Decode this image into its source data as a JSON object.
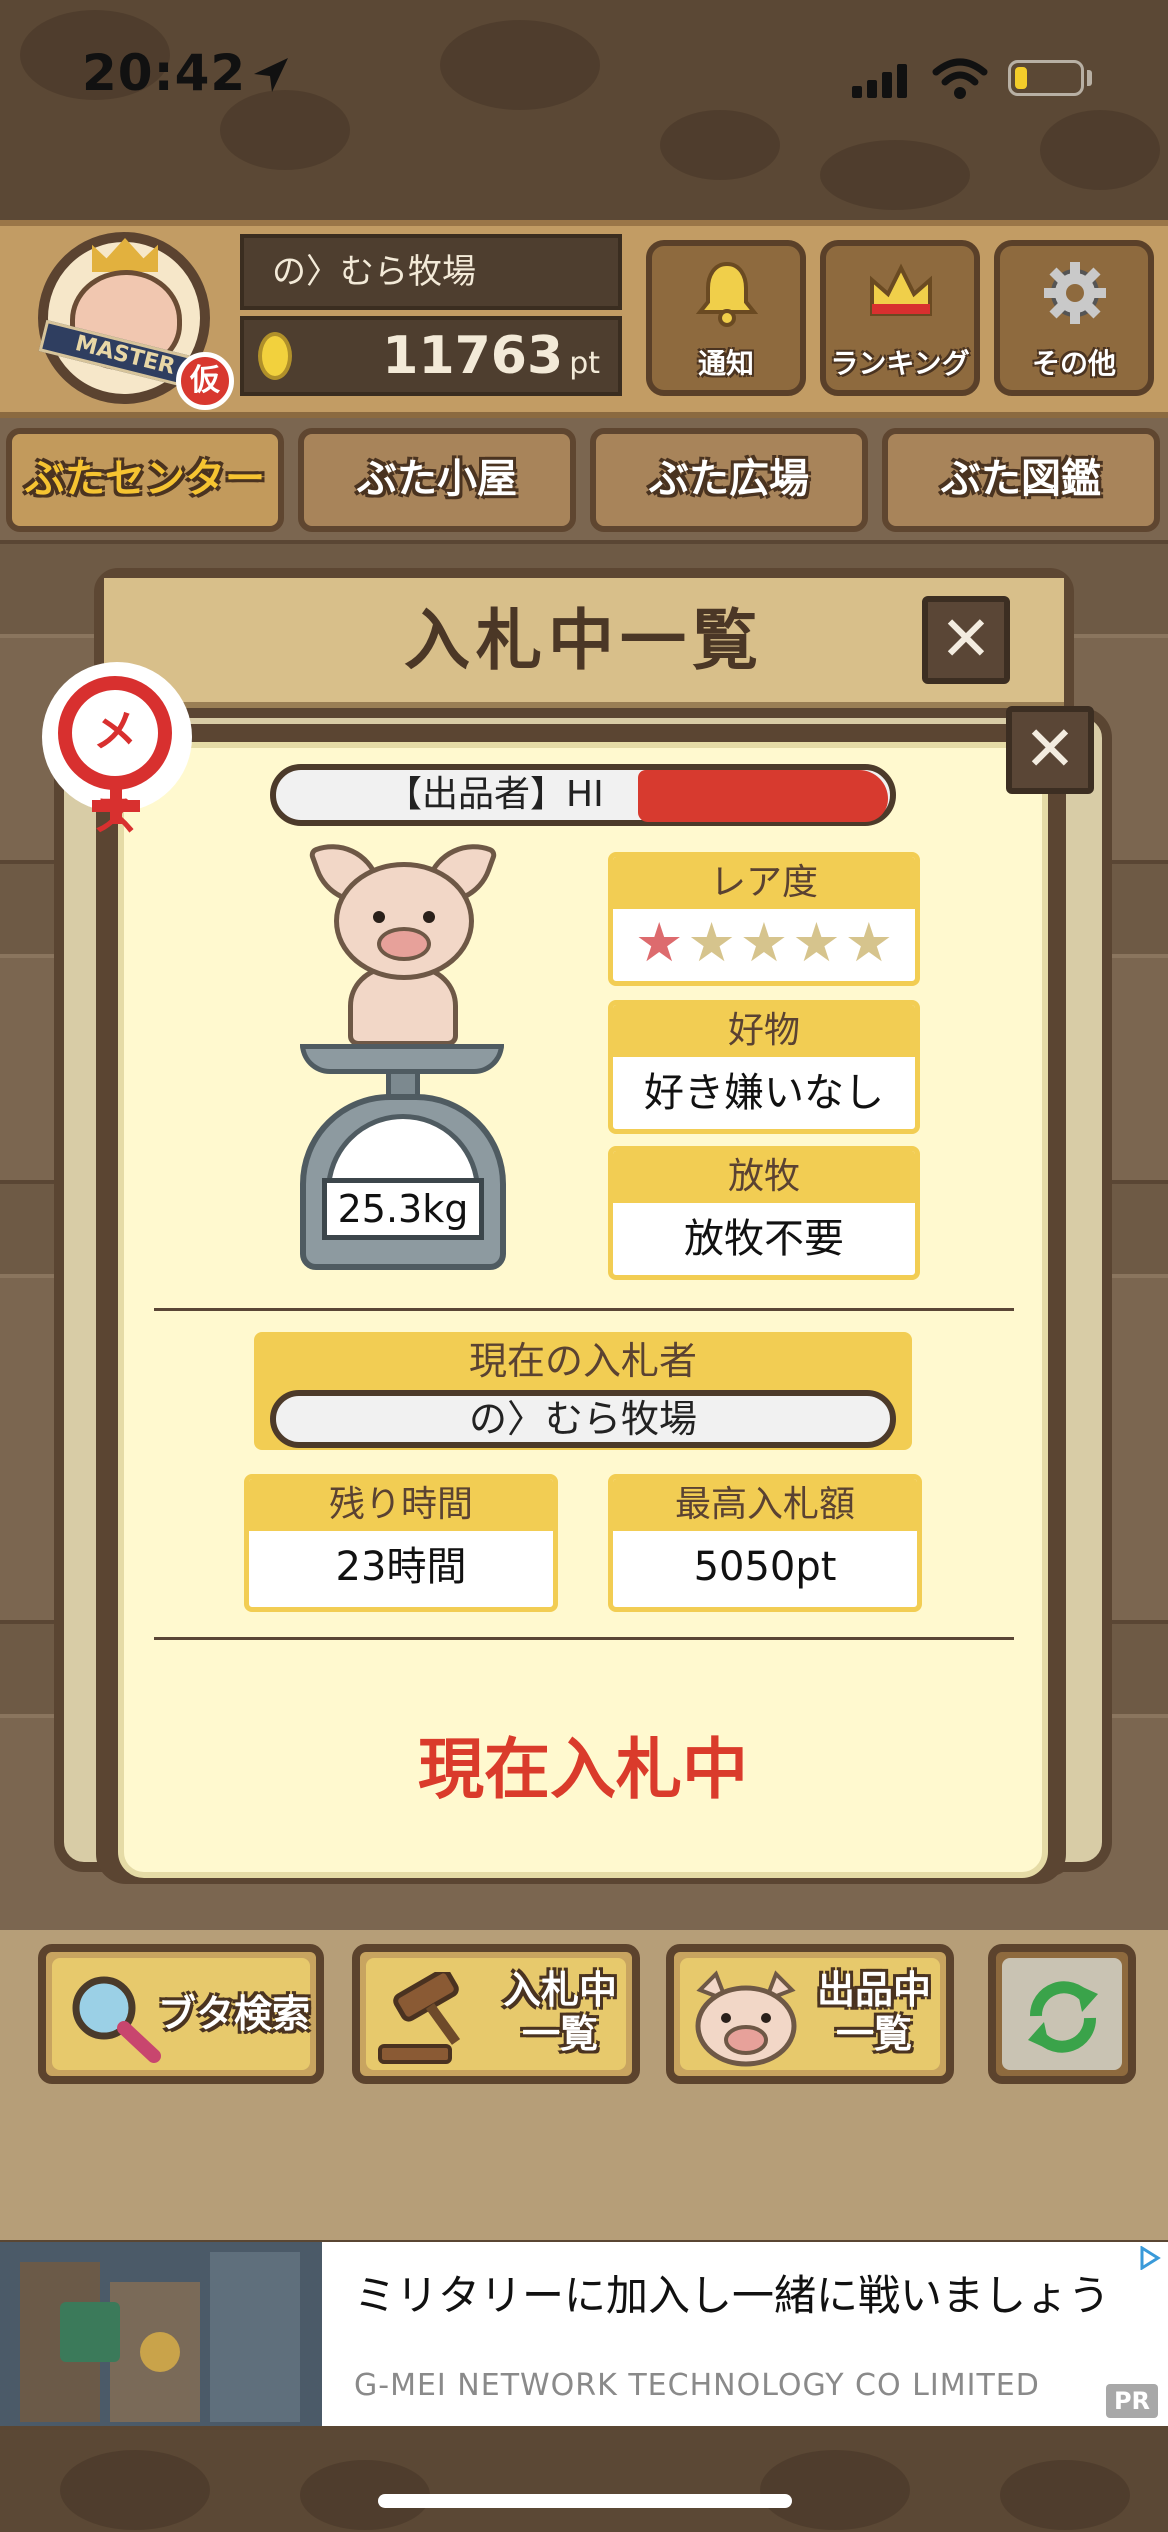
{
  "status_bar": {
    "time": "20:42"
  },
  "header": {
    "avatar_band": "MASTER",
    "temp_badge": "仮",
    "farm_name": "の〉むら牧場",
    "points_value": "11763",
    "points_unit": "pt",
    "buttons": [
      {
        "label": "通知",
        "icon": "bell-icon"
      },
      {
        "label": "ランキング",
        "icon": "crown-icon"
      },
      {
        "label": "その他",
        "icon": "gear-icon"
      }
    ]
  },
  "tabs": [
    {
      "label": "ぶたセンター",
      "active": true
    },
    {
      "label": "ぶた小屋",
      "active": false
    },
    {
      "label": "ぶた広場",
      "active": false
    },
    {
      "label": "ぶた図鑑",
      "active": false
    }
  ],
  "list_modal": {
    "title": "入札中一覧",
    "close_glyph": "✕"
  },
  "detail": {
    "gender": "メス",
    "seller_label": "【出品者】HI",
    "weight": "25.3kg",
    "rarity": {
      "label": "レア度",
      "stars_on": 1,
      "stars_total": 5
    },
    "favorite": {
      "label": "好物",
      "value": "好き嫌いなし"
    },
    "grazing": {
      "label": "放牧",
      "value": "放牧不要"
    },
    "current_bidder": {
      "label": "現在の入札者",
      "value": "の〉むら牧場"
    },
    "time_left": {
      "label": "残り時間",
      "value": "23時間"
    },
    "highest_bid": {
      "label": "最高入札額",
      "value": "5050pt"
    },
    "status": "現在入札中",
    "close_glyph": "✕"
  },
  "actions": [
    {
      "label": "ブタ検索",
      "icon": "magnifier-icon"
    },
    {
      "label_line1": "入札中",
      "label_line2": "一覧",
      "icon": "gavel-icon"
    },
    {
      "label_line1": "出品中",
      "label_line2": "一覧",
      "icon": "pig-face-icon"
    },
    {
      "label": "",
      "icon": "refresh-icon"
    }
  ],
  "ad": {
    "title": "ミリタリーに加入し一緒に戦いましょう",
    "company": "G-MEI NETWORK TECHNOLOGY CO LIMITED",
    "badge": "PR"
  },
  "colors": {
    "accent_yellow": "#f2cd53",
    "status_red": "#da3b2b",
    "wood_dark": "#5a4532"
  }
}
